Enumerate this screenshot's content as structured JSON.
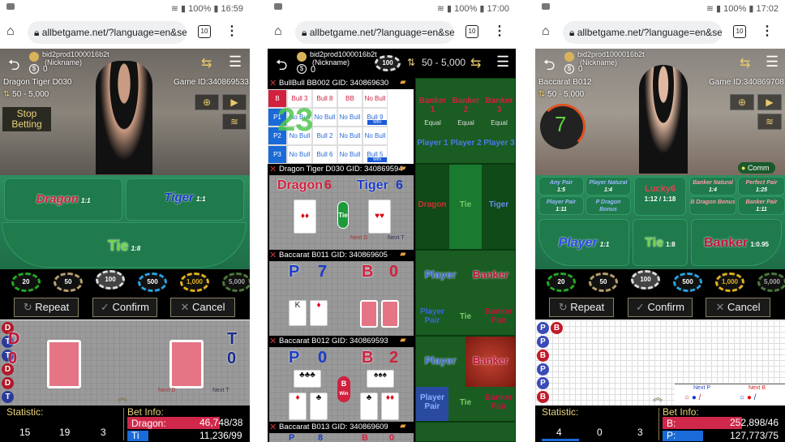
{
  "phones": [
    {
      "status": {
        "battery": "100%",
        "time": "16:59"
      },
      "browser": {
        "url": "allbetgame.net/?language=en&ses",
        "tab_count": "10"
      },
      "user": {
        "id": "bid2prod1000016b2t",
        "nickname": "(Nickname)",
        "balance": "0"
      },
      "table_name": "Dragon Tiger D030",
      "game_id": "Game ID:340869533",
      "limit": "50 - 5,000",
      "stop_betting": "Stop Betting",
      "bets": [
        {
          "label": "Dragon",
          "odds": "1:1"
        },
        {
          "label": "Tiger",
          "odds": "1:1"
        },
        {
          "label": "Tie",
          "odds": "1:8"
        }
      ],
      "chips": [
        "20",
        "50",
        "100",
        "500",
        "1,000",
        "5,000"
      ],
      "buttons": {
        "repeat": "Repeat",
        "confirm": "Confirm",
        "cancel": "Cancel"
      },
      "score": {
        "d_label": "D",
        "d_value": "0",
        "t_label": "T",
        "t_value": "0"
      },
      "beads": [
        "D",
        "T",
        "T",
        "D",
        "D",
        "T"
      ],
      "next": [
        "Next D",
        "Next T"
      ],
      "statistic": {
        "label": "Statistic:",
        "values": [
          "15",
          "19",
          "3"
        ]
      },
      "bet_info": {
        "label": "Bet Info:",
        "rows": [
          {
            "name": "Dragon:",
            "value": "46,748/38"
          },
          {
            "name": "Ti",
            "value": "11,236/99"
          }
        ]
      }
    },
    {
      "status": {
        "battery": "100%",
        "time": "17:00"
      },
      "browser": {
        "url": "allbetgame.net/?language=en&ses",
        "tab_count": "10"
      },
      "user": {
        "id": "bid2prod1000016b2t",
        "nickname": "(Nickname)",
        "balance": "0"
      },
      "chip": "100",
      "limit": "50 - 5,000",
      "tables": [
        {
          "title": "BullBull BB002 GID: 340869630",
          "countdown": "23",
          "grid": [
            [
              "B",
              "Bull 3",
              "Bull 8",
              "BB",
              "No Bull"
            ],
            [
              "P1",
              "No Bull",
              "No Bull",
              "No Bull",
              "Bull 9"
            ],
            [
              "P2",
              "No Bull",
              "Bull 2",
              "No Bull",
              "No Bull"
            ],
            [
              "P3",
              "No Bull",
              "Bull 6",
              "No Bull",
              "Bull 5"
            ]
          ],
          "win": "WIN",
          "bets": {
            "banker": [
              "Banker 1",
              "Banker 2",
              "Banker 3"
            ],
            "equal": "Equal",
            "player": [
              "Player 1",
              "Player 2",
              "Player 3"
            ]
          }
        },
        {
          "title": "Dragon Tiger D030 GID: 340869594",
          "dragon": "Dragon",
          "dragon_score": "6",
          "tiger": "Tiger",
          "tiger_score": "6",
          "tie": "Tie",
          "next": [
            "Next D",
            "Next T"
          ],
          "bets": [
            "Dragon",
            "Tie",
            "Tiger"
          ]
        },
        {
          "title": "Baccarat B011 GID: 340869605",
          "p": "P",
          "p_score": "7",
          "b": "B",
          "b_score": "0",
          "bets": [
            "Player",
            "Banker",
            "Player Pair",
            "Tie",
            "Banker Pair"
          ]
        },
        {
          "title": "Baccarat B012 GID: 340869593",
          "p": "P",
          "p_score": "0",
          "b": "B",
          "b_score": "2",
          "result": "B",
          "result_sub": "Win",
          "bets": [
            "Player",
            "Banker",
            "Player Pair",
            "Tie",
            "Banker Pair"
          ]
        },
        {
          "title": "Baccarat B013 GID: 340869609",
          "p": "P",
          "p_score": "8",
          "b": "B",
          "b_score": "0"
        }
      ]
    },
    {
      "status": {
        "battery": "100%",
        "time": "17:02"
      },
      "browser": {
        "url": "allbetgame.net/?language=en&ses",
        "tab_count": "10"
      },
      "user": {
        "id": "bid2prod1000016b2t",
        "nickname": "(Nickname)",
        "balance": "0"
      },
      "table_name": "Baccarat B012",
      "game_id": "Game ID:340869708",
      "limit": "50 - 5,000",
      "countdown": "7",
      "comm": "Comm",
      "side_bets": [
        {
          "label": "Any Pair",
          "odds": "1:5"
        },
        {
          "label": "Player Natural",
          "odds": "1:4"
        },
        {
          "label": "Player Pair",
          "odds": "1:11"
        },
        {
          "label": "P Dragon Bonus",
          "odds": ""
        },
        {
          "label": "Banker Natural",
          "odds": "1:4"
        },
        {
          "label": "Perfect Pair",
          "odds": "1:25"
        },
        {
          "label": "B Dragon Bonus",
          "odds": ""
        },
        {
          "label": "Banker Pair",
          "odds": "1:11"
        }
      ],
      "lucky6": {
        "label": "Lucky6",
        "odds": "1:12 / 1:18"
      },
      "bets": [
        {
          "label": "Player",
          "odds": "1:1"
        },
        {
          "label": "Tie",
          "odds": "1:8"
        },
        {
          "label": "Banker",
          "odds": "1:0.95"
        }
      ],
      "chips": [
        "20",
        "50",
        "100",
        "500",
        "1,000",
        "5,000"
      ],
      "buttons": {
        "repeat": "Repeat",
        "confirm": "Confirm",
        "cancel": "Cancel"
      },
      "beads": [
        "P",
        "B",
        "P",
        "B",
        "P",
        "P",
        "B"
      ],
      "next": [
        "Next P",
        "Next B"
      ],
      "statistic": {
        "label": "Statistic:",
        "values": [
          "4",
          "0",
          "3"
        ]
      },
      "bet_info": {
        "label": "Bet Info:",
        "rows": [
          {
            "name": "B:",
            "value": "252,898/46"
          },
          {
            "name": "P:",
            "value": "127,773/75"
          }
        ]
      }
    }
  ],
  "colors": {
    "dragon": "#d0213f",
    "tiger": "#1a3cc8",
    "tie": "#5fc43a",
    "gold": "#e8d27a",
    "felt": "#1f7a4c"
  }
}
